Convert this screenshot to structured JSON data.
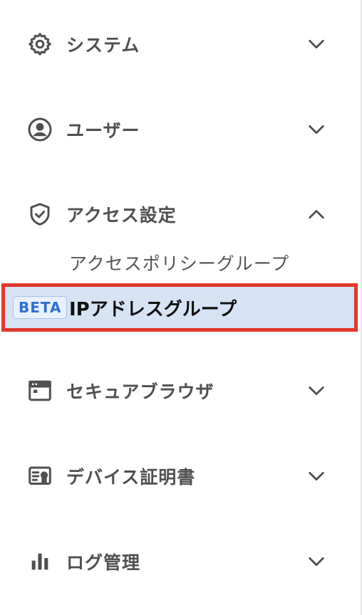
{
  "nav": {
    "items": [
      {
        "label": "システム",
        "icon": "gear-icon",
        "expanded": false
      },
      {
        "label": "ユーザー",
        "icon": "user-circle-icon",
        "expanded": false
      },
      {
        "label": "アクセス設定",
        "icon": "shield-check-icon",
        "expanded": true
      },
      {
        "label": "セキュアブラウザ",
        "icon": "browser-window-icon",
        "expanded": false
      },
      {
        "label": "デバイス証明書",
        "icon": "certificate-icon",
        "expanded": false
      },
      {
        "label": "ログ管理",
        "icon": "bar-chart-icon",
        "expanded": false
      }
    ],
    "access_sub_items": [
      {
        "label": "アクセスポリシーグループ",
        "selected": false
      },
      {
        "label": "IPアドレスグループ",
        "badge": "BETA",
        "selected": true
      }
    ]
  },
  "colors": {
    "highlight_border": "#e0392a",
    "selected_background": "#d6e3f5",
    "badge_text": "#2f6fd0",
    "icon": "#505050"
  }
}
